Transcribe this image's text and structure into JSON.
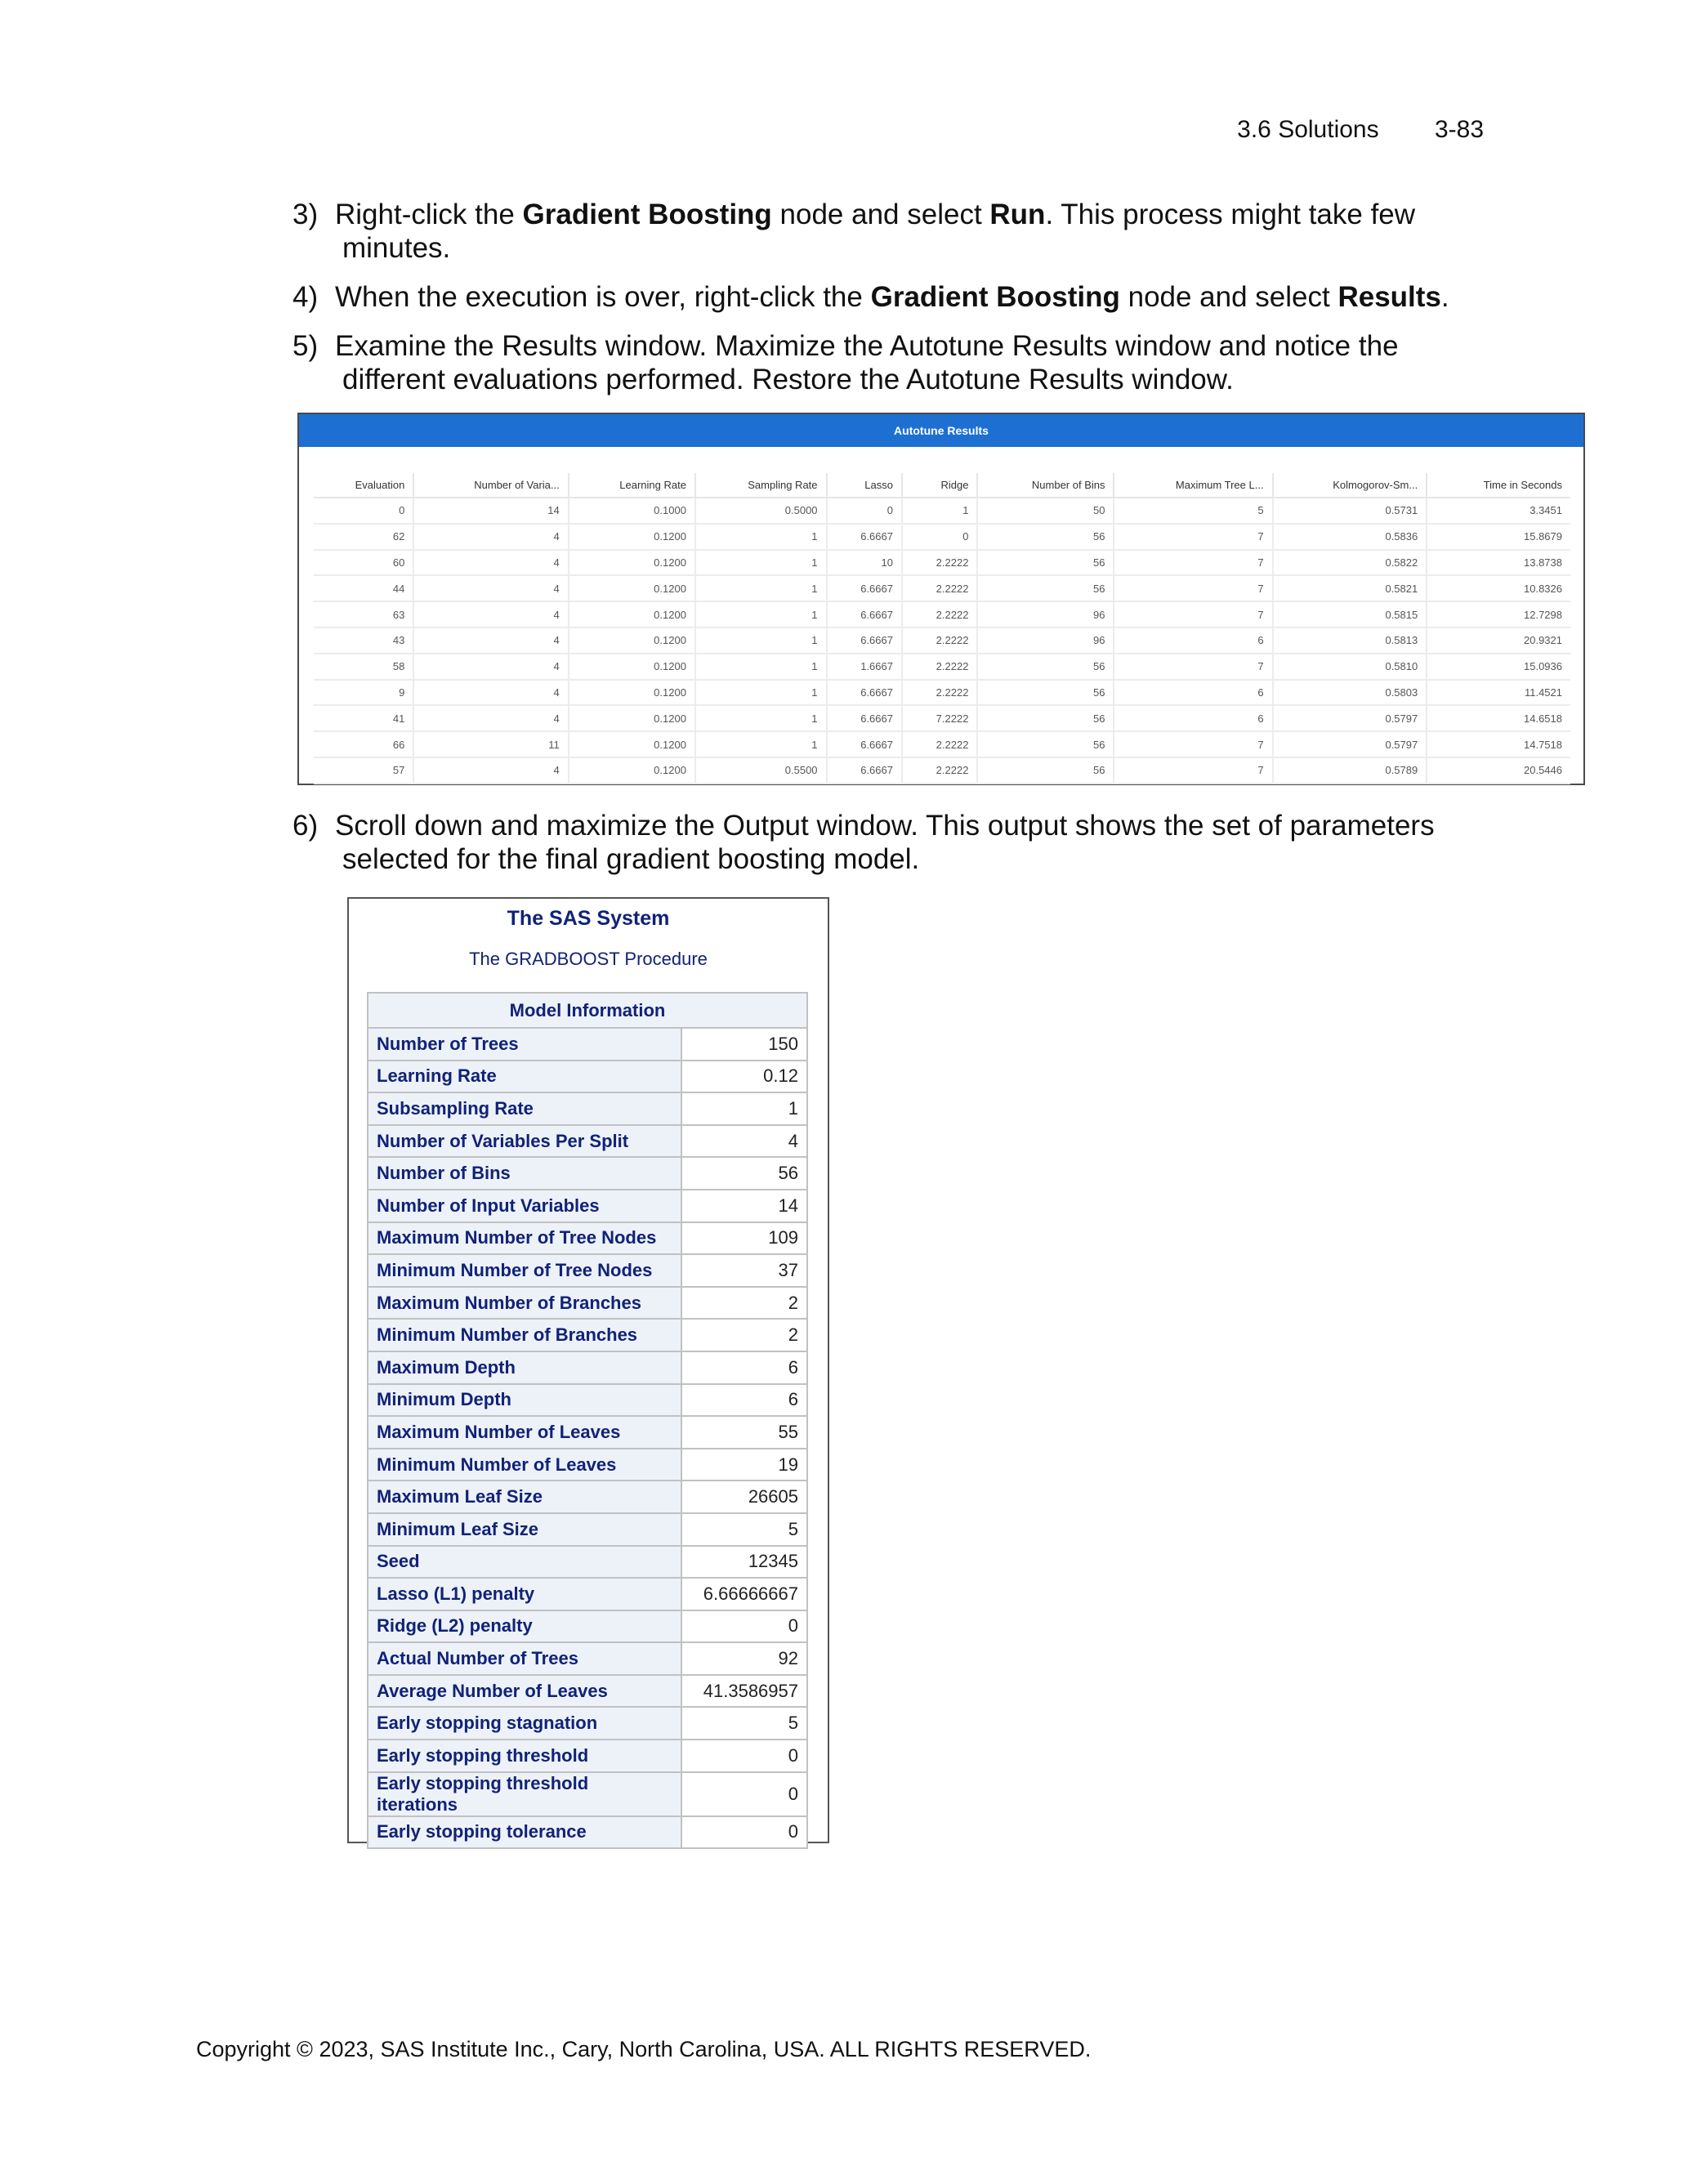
{
  "header": {
    "section": "3.6  Solutions",
    "page": "3-83"
  },
  "steps": {
    "s3": {
      "num": "3)",
      "pre": "Right-click the ",
      "b1": "Gradient Boosting",
      "mid": " node and select ",
      "b2": "Run",
      "post": ". This process might take few",
      "line2": "minutes."
    },
    "s4": {
      "num": "4)",
      "pre": "When the execution is over, right-click the ",
      "b1": "Gradient Boosting",
      "mid": " node and select ",
      "b2": "Results",
      "post": "."
    },
    "s5": {
      "num": "5)",
      "line1": "Examine the Results window. Maximize the Autotune Results window and notice the",
      "line2": "different evaluations performed. Restore the Autotune Results window."
    },
    "s6": {
      "num": "6)",
      "line1": "Scroll down and maximize the Output window. This output shows the set of parameters",
      "line2": "selected for the final gradient boosting model."
    }
  },
  "autotune": {
    "title": "Autotune Results",
    "columns": [
      "Evaluation",
      "Number of Varia...",
      "Learning Rate",
      "Sampling Rate",
      "Lasso",
      "Ridge",
      "Number of Bins",
      "Maximum Tree L...",
      "Kolmogorov-Sm...",
      "Time in Seconds"
    ],
    "rows": [
      [
        "0",
        "14",
        "0.1000",
        "0.5000",
        "0",
        "1",
        "50",
        "5",
        "0.5731",
        "3.3451"
      ],
      [
        "62",
        "4",
        "0.1200",
        "1",
        "6.6667",
        "0",
        "56",
        "7",
        "0.5836",
        "15.8679"
      ],
      [
        "60",
        "4",
        "0.1200",
        "1",
        "10",
        "2.2222",
        "56",
        "7",
        "0.5822",
        "13.8738"
      ],
      [
        "44",
        "4",
        "0.1200",
        "1",
        "6.6667",
        "2.2222",
        "56",
        "7",
        "0.5821",
        "10.8326"
      ],
      [
        "63",
        "4",
        "0.1200",
        "1",
        "6.6667",
        "2.2222",
        "96",
        "7",
        "0.5815",
        "12.7298"
      ],
      [
        "43",
        "4",
        "0.1200",
        "1",
        "6.6667",
        "2.2222",
        "96",
        "6",
        "0.5813",
        "20.9321"
      ],
      [
        "58",
        "4",
        "0.1200",
        "1",
        "1.6667",
        "2.2222",
        "56",
        "7",
        "0.5810",
        "15.0936"
      ],
      [
        "9",
        "4",
        "0.1200",
        "1",
        "6.6667",
        "2.2222",
        "56",
        "6",
        "0.5803",
        "11.4521"
      ],
      [
        "41",
        "4",
        "0.1200",
        "1",
        "6.6667",
        "7.2222",
        "56",
        "6",
        "0.5797",
        "14.6518"
      ],
      [
        "66",
        "11",
        "0.1200",
        "1",
        "6.6667",
        "2.2222",
        "56",
        "7",
        "0.5797",
        "14.7518"
      ],
      [
        "57",
        "4",
        "0.1200",
        "0.5500",
        "6.6667",
        "2.2222",
        "56",
        "7",
        "0.5789",
        "20.5446"
      ]
    ]
  },
  "sas": {
    "title": "The SAS System",
    "subtitle": "The GRADBOOST Procedure",
    "table_header": "Model Information",
    "rows": [
      [
        "Number of Trees",
        "150"
      ],
      [
        "Learning Rate",
        "0.12"
      ],
      [
        "Subsampling Rate",
        "1"
      ],
      [
        "Number of Variables Per Split",
        "4"
      ],
      [
        "Number of Bins",
        "56"
      ],
      [
        "Number of Input Variables",
        "14"
      ],
      [
        "Maximum Number of Tree Nodes",
        "109"
      ],
      [
        "Minimum Number of Tree Nodes",
        "37"
      ],
      [
        "Maximum Number of Branches",
        "2"
      ],
      [
        "Minimum Number of Branches",
        "2"
      ],
      [
        "Maximum Depth",
        "6"
      ],
      [
        "Minimum Depth",
        "6"
      ],
      [
        "Maximum Number of Leaves",
        "55"
      ],
      [
        "Minimum Number of Leaves",
        "19"
      ],
      [
        "Maximum Leaf Size",
        "26605"
      ],
      [
        "Minimum Leaf Size",
        "5"
      ],
      [
        "Seed",
        "12345"
      ],
      [
        "Lasso (L1) penalty",
        "6.66666667"
      ],
      [
        "Ridge (L2) penalty",
        "0"
      ],
      [
        "Actual Number of Trees",
        "92"
      ],
      [
        "Average Number of Leaves",
        "41.3586957"
      ],
      [
        "Early stopping stagnation",
        "5"
      ],
      [
        "Early stopping threshold",
        "0"
      ],
      [
        "Early stopping threshold iterations",
        "0"
      ],
      [
        "Early stopping tolerance",
        "0"
      ]
    ]
  },
  "footer": "Copyright © 2023, SAS Institute Inc., Cary, North Carolina, USA. ALL RIGHTS RESERVED."
}
